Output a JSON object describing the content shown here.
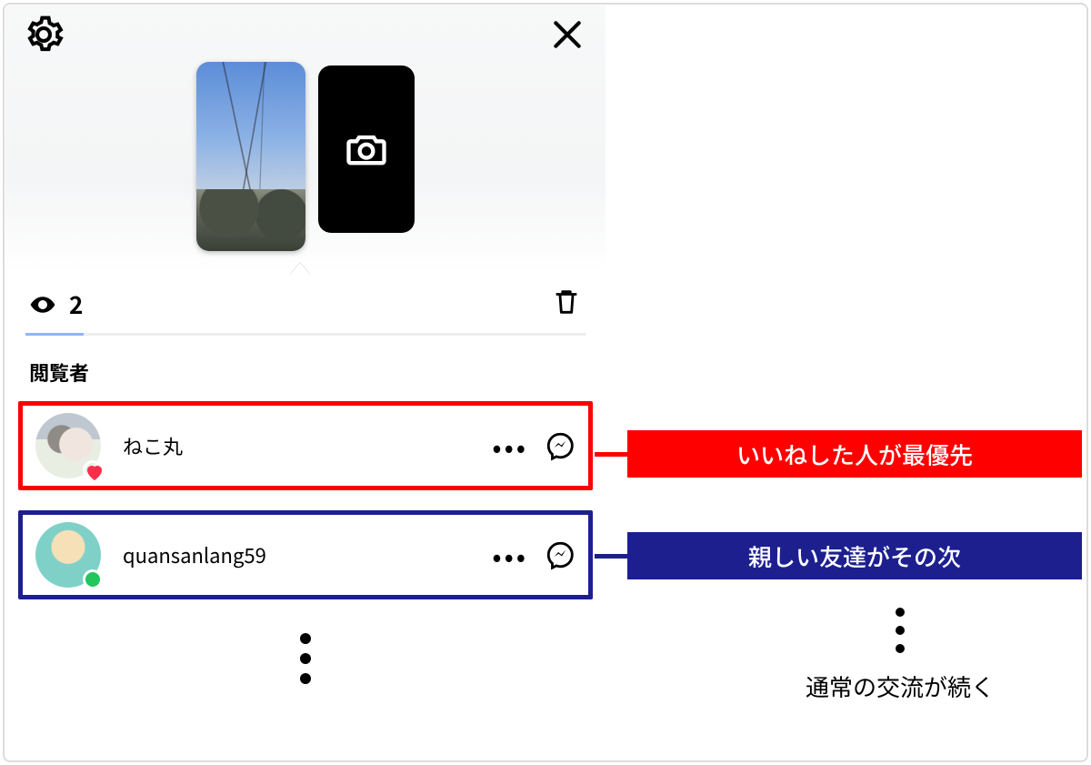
{
  "story": {
    "view_count_on_thumb": "2",
    "view_count": "2"
  },
  "section_title": "閲覧者",
  "viewers": [
    {
      "name": "ねこ丸",
      "badge": "heart"
    },
    {
      "name": "quansanlang59",
      "badge": "online"
    }
  ],
  "annotations": {
    "liked_first": "いいねした人が最優先",
    "close_second": "親しい友達がその次",
    "normal_follow": "通常の交流が続く"
  },
  "colors": {
    "red": "#ff0000",
    "blue": "#1d1f8f"
  }
}
